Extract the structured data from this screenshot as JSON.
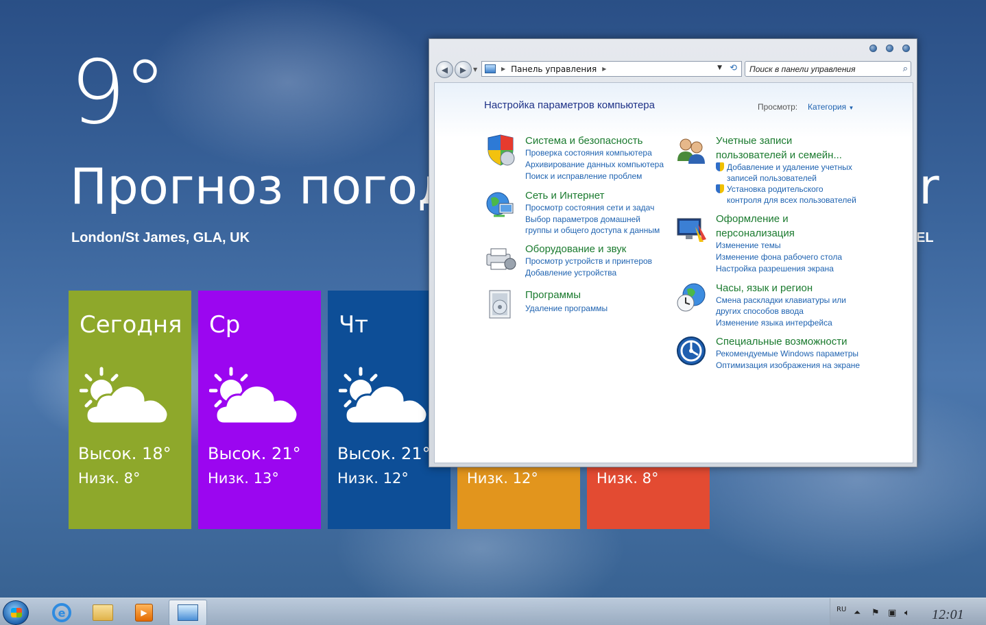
{
  "weather": {
    "temperature": "9°",
    "title": "Прогноз погоды",
    "title_tail": "r",
    "location": "London/St James, GLA, UK",
    "location_tail": "EL",
    "days": [
      {
        "name": "Сегодня",
        "high": "Высок. 18°",
        "low": "Низк. 8°",
        "color": "#8ea82b",
        "icon": "partly-cloudy-icon"
      },
      {
        "name": "Ср",
        "high": "Высок. 21°",
        "low": "Низк. 13°",
        "color": "#9b06f0",
        "icon": "partly-cloudy-icon"
      },
      {
        "name": "Чт",
        "high": "Высок. 21°",
        "low": "Низк. 12°",
        "color": "#0d4e97",
        "icon": "partly-cloudy-icon"
      },
      {
        "name": "",
        "high": "",
        "low": "Низк. 12°",
        "color": "#e2951d",
        "icon": ""
      },
      {
        "name": "",
        "high": "",
        "low": "Низк. 8°",
        "color": "#e34b32",
        "icon": ""
      }
    ]
  },
  "window": {
    "address": "Панель управления",
    "search_placeholder": "Поиск в панели управления",
    "page_title": "Настройка параметров компьютера",
    "view_by_label": "Просмотр:",
    "view_by_value": "Категория",
    "categories_left": [
      {
        "title": "Система и безопасность",
        "icon": "system-security-icon",
        "links": [
          "Проверка состояния компьютера",
          "Архивирование данных компьютера",
          "Поиск и исправление проблем"
        ]
      },
      {
        "title": "Сеть и Интернет",
        "icon": "network-icon",
        "links": [
          "Просмотр состояния сети и задач",
          "Выбор параметров домашней",
          "группы и общего доступа к данным"
        ]
      },
      {
        "title": "Оборудование и звук",
        "icon": "hardware-sound-icon",
        "links": [
          "Просмотр устройств и принтеров",
          "Добавление устройства"
        ]
      },
      {
        "title": "Программы",
        "icon": "programs-icon",
        "links": [
          "Удаление программы"
        ]
      }
    ],
    "categories_right": [
      {
        "title_lines": [
          "Учетные записи",
          "пользователей и семейн..."
        ],
        "icon": "user-accounts-icon",
        "links": [
          "Добавление и удаление учетных",
          "записей пользователей",
          "Установка родительского",
          "контроля для всех пользователей"
        ]
      },
      {
        "title_lines": [
          "Оформление и",
          "персонализация"
        ],
        "icon": "appearance-icon",
        "links": [
          "Изменение темы",
          "Изменение фона рабочего стола",
          "Настройка разрешения экрана"
        ]
      },
      {
        "title_lines": [
          "Часы, язык и регион"
        ],
        "icon": "clock-region-icon",
        "links": [
          "Смена раскладки клавиатуры или",
          "других способов ввода",
          "Изменение языка интерфейса"
        ]
      },
      {
        "title_lines": [
          "Специальные возможности"
        ],
        "icon": "ease-of-access-icon",
        "links": [
          "Рекомендуемые Windows параметры",
          "Оптимизация изображения на экране"
        ]
      }
    ]
  },
  "taskbar": {
    "language": "RU",
    "clock": "12:01"
  }
}
